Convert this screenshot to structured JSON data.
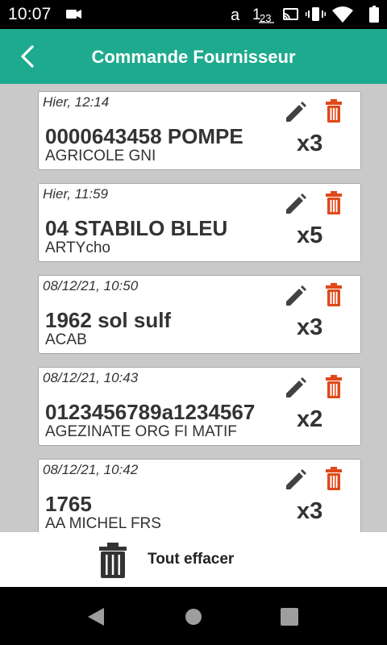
{
  "status_bar": {
    "time": "10:07",
    "icons": [
      "video-recording-icon",
      "font-a-icon",
      "keyboard-123-icon",
      "cast-icon",
      "vibrate-icon",
      "wifi-icon",
      "battery-icon"
    ]
  },
  "app_bar": {
    "title": "Commande Fournisseur",
    "back_icon": "chevron-left-icon"
  },
  "colors": {
    "primary": "#1eaa8e",
    "delete": "#e0481a",
    "background": "#c9c9c9"
  },
  "orders": [
    {
      "date": "Hier, 12:14",
      "title": "0000643458 POMPE",
      "supplier": "AGRICOLE GNI",
      "quantity": "x3"
    },
    {
      "date": "Hier, 11:59",
      "title": "04 STABILO BLEU",
      "supplier": "ARTYcho",
      "quantity": "x5"
    },
    {
      "date": "08/12/21, 10:50",
      "title": "1962 sol sulf",
      "supplier": "ACAB",
      "quantity": "x3"
    },
    {
      "date": "08/12/21, 10:43",
      "title": "0123456789a1234567",
      "supplier": "AGEZINATE ORG FI MATIF",
      "quantity": "x2"
    },
    {
      "date": "08/12/21, 10:42",
      "title": "1765",
      "supplier": "AA MICHEL FRS",
      "quantity": "x3"
    }
  ],
  "bottom_bar": {
    "clear_label": "Tout effacer"
  }
}
